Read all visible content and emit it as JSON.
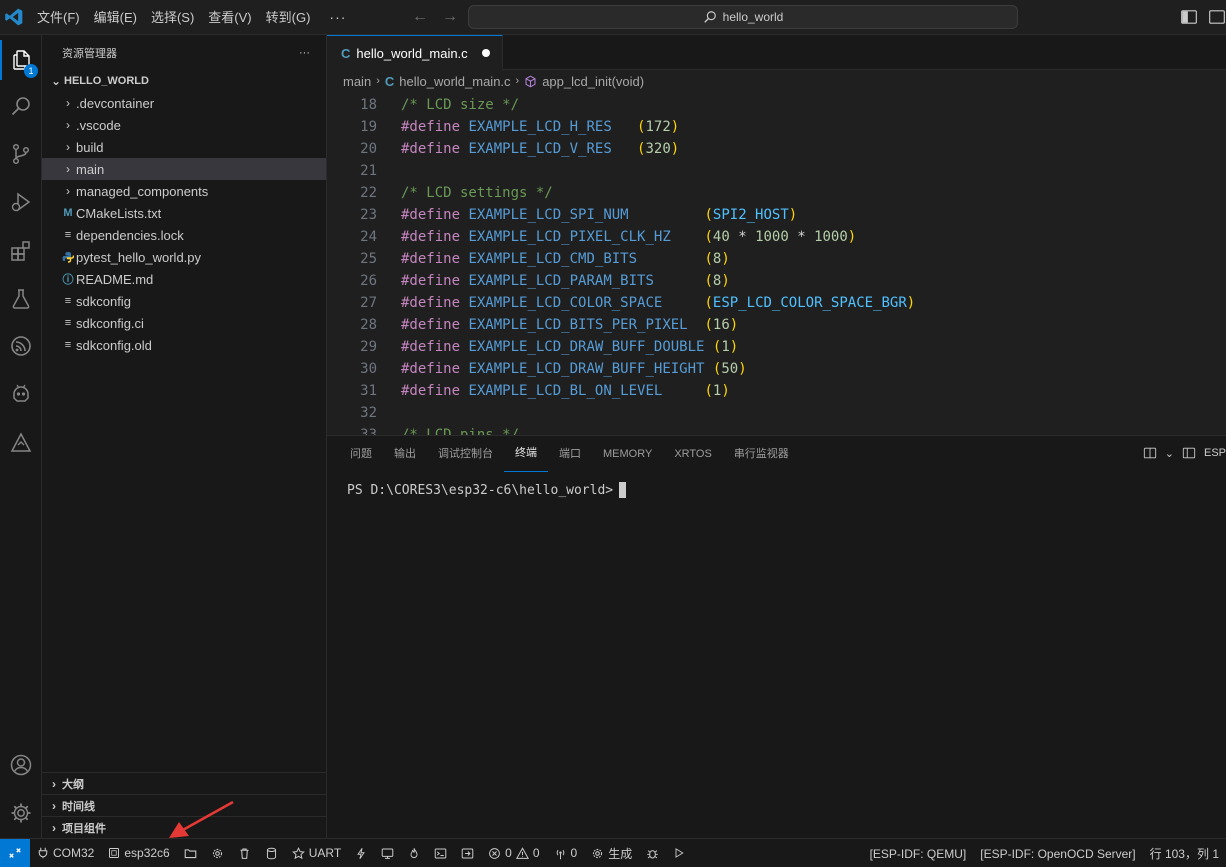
{
  "titlebar": {
    "menu": [
      "文件(F)",
      "编辑(E)",
      "选择(S)",
      "查看(V)",
      "转到(G)"
    ],
    "more": "···",
    "search_text": "hello_world"
  },
  "activity": {
    "explorer_badge": "1",
    "icons": [
      "files-icon",
      "search-icon",
      "source-control-icon",
      "run-debug-icon",
      "extensions-icon",
      "testing-icon",
      "espressif-icon",
      "platformio-icon",
      "esp-idf-icon",
      "account-icon",
      "settings-gear-icon"
    ]
  },
  "sidebar": {
    "title": "资源管理器",
    "more": "···",
    "folder": "HELLO_WORLD",
    "items": [
      {
        "label": ".devcontainer",
        "type": "folder"
      },
      {
        "label": ".vscode",
        "type": "folder"
      },
      {
        "label": "build",
        "type": "folder"
      },
      {
        "label": "main",
        "type": "folder",
        "selected": true
      },
      {
        "label": "managed_components",
        "type": "folder"
      },
      {
        "label": "CMakeLists.txt",
        "type": "cmake"
      },
      {
        "label": "dependencies.lock",
        "type": "text"
      },
      {
        "label": "pytest_hello_world.py",
        "type": "python"
      },
      {
        "label": "README.md",
        "type": "markdown"
      },
      {
        "label": "sdkconfig",
        "type": "text"
      },
      {
        "label": "sdkconfig.ci",
        "type": "text"
      },
      {
        "label": "sdkconfig.old",
        "type": "text"
      }
    ],
    "sections": [
      "大纲",
      "时间线",
      "项目组件"
    ]
  },
  "editor": {
    "tab_label": "hello_world_main.c",
    "tab_icon": "C",
    "breadcrumb": {
      "folder": "main",
      "file": "hello_world_main.c",
      "symbol": "app_lcd_init(void)"
    },
    "lines": [
      {
        "n": "18",
        "text": "/* LCD size */"
      },
      {
        "n": "19",
        "text": "#define EXAMPLE_LCD_H_RES   (172)"
      },
      {
        "n": "20",
        "text": "#define EXAMPLE_LCD_V_RES   (320)"
      },
      {
        "n": "21",
        "text": ""
      },
      {
        "n": "22",
        "text": "/* LCD settings */"
      },
      {
        "n": "23",
        "text": "#define EXAMPLE_LCD_SPI_NUM         (SPI2_HOST)"
      },
      {
        "n": "24",
        "text": "#define EXAMPLE_LCD_PIXEL_CLK_HZ    (40 * 1000 * 1000)"
      },
      {
        "n": "25",
        "text": "#define EXAMPLE_LCD_CMD_BITS        (8)"
      },
      {
        "n": "26",
        "text": "#define EXAMPLE_LCD_PARAM_BITS      (8)"
      },
      {
        "n": "27",
        "text": "#define EXAMPLE_LCD_COLOR_SPACE     (ESP_LCD_COLOR_SPACE_BGR)"
      },
      {
        "n": "28",
        "text": "#define EXAMPLE_LCD_BITS_PER_PIXEL  (16)"
      },
      {
        "n": "29",
        "text": "#define EXAMPLE_LCD_DRAW_BUFF_DOUBLE (1)"
      },
      {
        "n": "30",
        "text": "#define EXAMPLE_LCD_DRAW_BUFF_HEIGHT (50)"
      },
      {
        "n": "31",
        "text": "#define EXAMPLE_LCD_BL_ON_LEVEL     (1)"
      },
      {
        "n": "32",
        "text": ""
      },
      {
        "n": "33",
        "text": "/* LCD pins */"
      }
    ]
  },
  "panel": {
    "tabs": [
      "问题",
      "输出",
      "调试控制台",
      "终端",
      "端口",
      "MEMORY",
      "XRTOS",
      "串行监视器"
    ],
    "active_tab": "终端",
    "right_label": "ESP",
    "terminal_prompt": "PS D:\\CORES3\\esp32-c6\\hello_world>"
  },
  "statusbar": {
    "port": "COM32",
    "target": "esp32c6",
    "uart": "UART",
    "errors": "0",
    "warnings": "0",
    "radio": "0",
    "build": "生成",
    "qemu": "[ESP-IDF: QEMU]",
    "openocd": "[ESP-IDF: OpenOCD Server]",
    "position": "行 103，列 1"
  },
  "colors": {
    "accent": "#0078d4",
    "annotation_arrow": "#e53935"
  }
}
